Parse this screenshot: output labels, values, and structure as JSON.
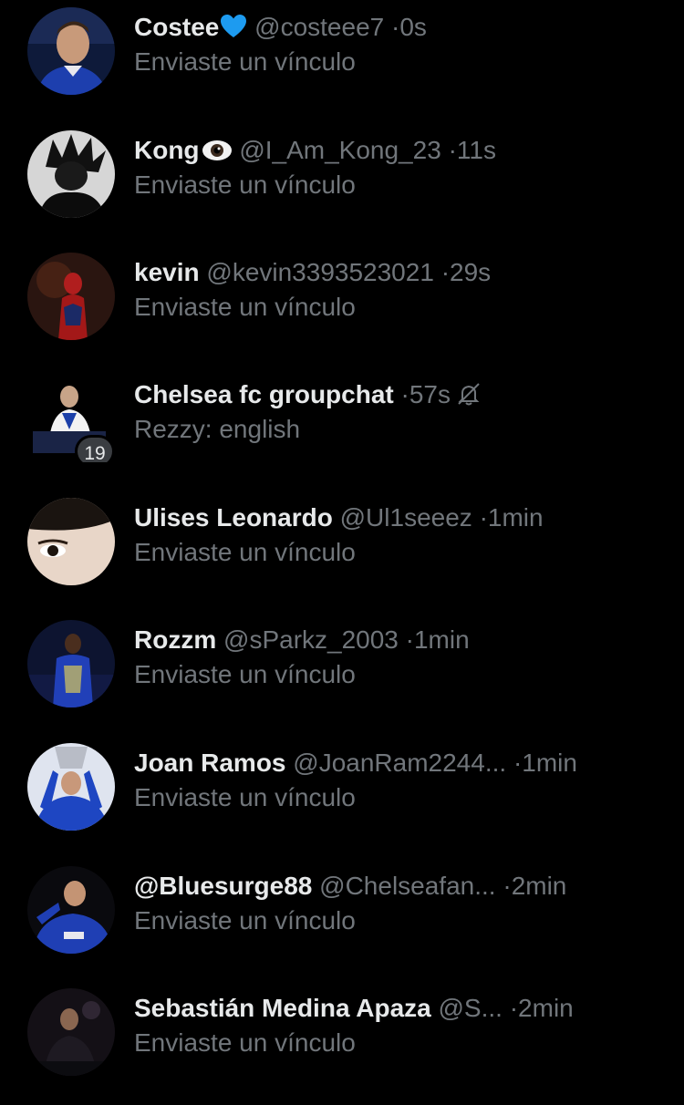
{
  "conversations": [
    {
      "name": "Costee",
      "handle": "@costeee7",
      "separator": "·",
      "time": "0s",
      "preview": "Enviaste un vínculo",
      "name_emoji": "blue-heart-icon"
    },
    {
      "name": "Kong",
      "handle": "@I_Am_Kong_23",
      "separator": "·",
      "time": "11s",
      "preview": "Enviaste un vínculo",
      "name_emoji": "eye-icon"
    },
    {
      "name": "kevin",
      "handle": "@kevin3393523021",
      "separator": "·",
      "time": "29s",
      "preview": "Enviaste un vínculo"
    },
    {
      "name": "Chelsea fc groupchat",
      "handle": "",
      "separator": "·",
      "time": "57s",
      "preview": "Rezzy: english",
      "muted_icon": "bell-slash-icon",
      "member_count": "19"
    },
    {
      "name": "Ulises Leonardo",
      "handle": "@Ul1seeez",
      "separator": "·",
      "time": "1min",
      "preview": "Enviaste un vínculo"
    },
    {
      "name": "Rozzm",
      "handle": "@sParkz_2003",
      "separator": "·",
      "time": "1min",
      "preview": "Enviaste un vínculo"
    },
    {
      "name": "Joan Ramos",
      "handle": "@JoanRam2244...",
      "separator": "·",
      "time": "1min",
      "preview": "Enviaste un vínculo"
    },
    {
      "name": "@Bluesurge88",
      "handle": "@Chelseafan...",
      "separator": "·",
      "time": "2min",
      "preview": "Enviaste un vínculo"
    },
    {
      "name": "Sebastián Medina Apaza",
      "handle": "@S...",
      "separator": "·",
      "time": "2min",
      "preview": "Enviaste un vínculo"
    }
  ],
  "colors": {
    "background": "#000000",
    "primary_text": "#e7e9ea",
    "secondary_text": "#71767b",
    "heart": "#1d9bf0"
  }
}
